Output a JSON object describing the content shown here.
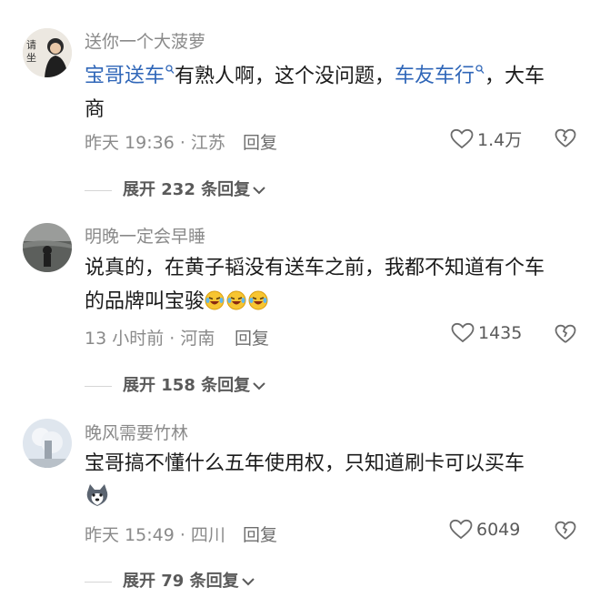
{
  "comments": [
    {
      "username": "送你一个大菠萝",
      "avatar_text": "请坐",
      "body": {
        "mention1": "宝哥送车",
        "text1": "有熟人啊，这个没问题，",
        "mention2": "车友车行",
        "text2": "，大车",
        "line2": "商"
      },
      "time_location": "昨天 19:36 · 江苏",
      "reply_label": "回复",
      "likes": "1.4万",
      "expand_label": "展开 232 条回复"
    },
    {
      "username": "明晚一定会早睡",
      "body": {
        "line1": "说真的，在黄子韬没有送车之前，我都不知道有个车",
        "line2": "的品牌叫宝骏"
      },
      "emoji": "laughing-crying-emoji",
      "time_location": "13 小时前 · 河南",
      "reply_label": "回复",
      "likes": "1435",
      "expand_label": "展开 158 条回复"
    },
    {
      "username": "晚风需要竹林",
      "body": {
        "line1": "宝哥搞不懂什么五年使用权，只知道刷卡可以买车"
      },
      "emoji": "husky-dog-emoji",
      "time_location": "昨天 15:49 · 四川",
      "reply_label": "回复",
      "likes": "6049",
      "expand_label": "展开 79 条回复"
    }
  ],
  "colors": {
    "mention": "#2f66b8",
    "meta": "#8a8a8a",
    "text": "#1b1b1b"
  },
  "icons": [
    "search-icon",
    "heart-icon",
    "dislike-heart-icon",
    "chevron-down-icon"
  ]
}
